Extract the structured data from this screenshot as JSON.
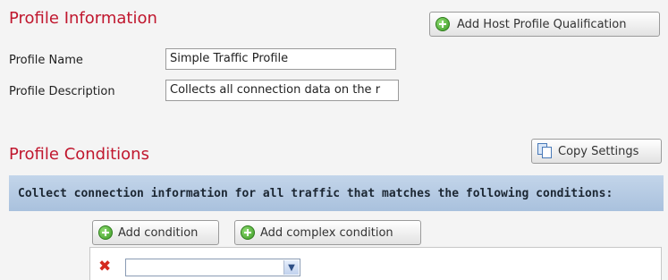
{
  "profile_info": {
    "title": "Profile Information",
    "add_host_button": "Add Host Profile Qualification",
    "name_label": "Profile Name",
    "name_value": "Simple Traffic Profile",
    "description_label": "Profile Description",
    "description_value": "Collects all connection data on the r"
  },
  "profile_conditions": {
    "title": "Profile Conditions",
    "copy_button": "Copy Settings",
    "banner_text": "Collect connection information for all traffic that matches the following conditions:",
    "add_condition_button": "Add condition",
    "add_complex_condition_button": "Add complex condition",
    "condition_select_value": ""
  },
  "icons": {
    "add": "plus-circle-icon",
    "copy": "copy-icon",
    "remove": "delete-x-icon",
    "dropdown": "chevron-down-icon"
  },
  "colors": {
    "title_red": "#c0172e",
    "banner_blue": "#b3c9e2",
    "add_green": "#3c9a25",
    "delete_red": "#d42a1f"
  }
}
